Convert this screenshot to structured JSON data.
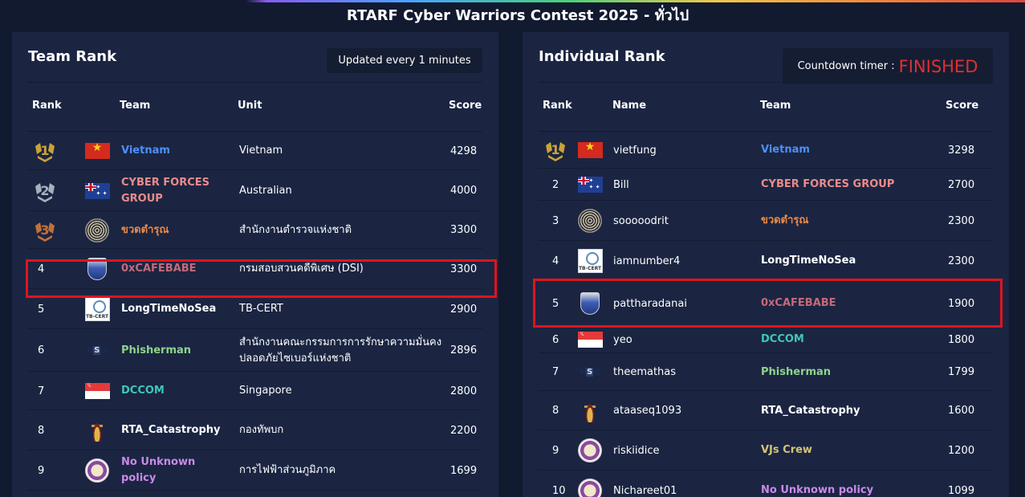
{
  "page": {
    "title": "RTARF Cyber Warriors Contest 2025 - ทั่วไป"
  },
  "team_rank": {
    "title": "Team Rank",
    "update_badge": "Updated every 1 minutes",
    "headers": {
      "rank": "Rank",
      "team": "Team",
      "unit": "Unit",
      "score": "Score"
    },
    "rows": [
      {
        "rank": "1",
        "rank_icon": "gold-medal-icon",
        "logo": "vietnam-flag-icon",
        "team": "Vietnam",
        "team_color": "#4f8ff7",
        "unit": "Vietnam",
        "score": "4298"
      },
      {
        "rank": "2",
        "rank_icon": "silver-medal-icon",
        "logo": "australia-flag-icon",
        "team": "CYBER FORCES GROUP",
        "team_color": "#ec8b8b",
        "unit": "Australian",
        "score": "4000"
      },
      {
        "rank": "3",
        "rank_icon": "bronze-medal-icon",
        "logo": "lace-logo-icon",
        "team": "ขวดตำรุณ",
        "team_color": "#e88a4a",
        "unit": "สำนักงานตำรวจแห่งชาติ",
        "score": "3300"
      },
      {
        "rank": "4",
        "logo": "shield-logo-icon",
        "team": "0xCAFEBABE",
        "team_color": "#c46a7a",
        "unit": "กรมสอบสวนคดีพิเศษ (DSI)",
        "score": "3300"
      },
      {
        "rank": "5",
        "logo": "tb-cert-logo-icon",
        "logo_text": "TB-CERT",
        "team": "LongTimeNoSea",
        "team_color": "#ffffff",
        "unit": "TB-CERT",
        "score": "2900"
      },
      {
        "rank": "6",
        "logo": "nsec-logo-icon",
        "team": "Phisherman",
        "team_color": "#8fd38a",
        "unit": "สำนักงานคณะกรรมการการรักษาความมั่นคงปลอดภัยไซเบอร์แห่งชาติ",
        "score": "2896"
      },
      {
        "rank": "7",
        "logo": "singapore-flag-icon",
        "team": "DCCOM",
        "team_color": "#3fc7b6",
        "unit": "Singapore",
        "score": "2800"
      },
      {
        "rank": "8",
        "logo": "army-emblem-icon",
        "team": "RTA_Catastrophy",
        "team_color": "#ffffff",
        "unit": "กองทัพบก",
        "score": "2200"
      },
      {
        "rank": "9",
        "logo": "purple-seal-icon",
        "team": "No Unknown policy",
        "team_color": "#c88ae8",
        "unit": "การไฟฟ้าส่วนภูมิภาค",
        "score": "1699"
      }
    ]
  },
  "individual_rank": {
    "title": "Individual Rank",
    "countdown_label": "Countdown timer :",
    "countdown_value": "FINISHED",
    "headers": {
      "rank": "Rank",
      "name": "Name",
      "team": "Team",
      "score": "Score"
    },
    "rows": [
      {
        "rank": "1",
        "rank_icon": "gold-medal-icon",
        "logo": "vietnam-flag-icon",
        "name": "vietfung",
        "team": "Vietnam",
        "team_color": "#4f8ff7",
        "score": "3298"
      },
      {
        "rank": "2",
        "logo": "australia-flag-icon",
        "name": "Bill",
        "team": "CYBER FORCES GROUP",
        "team_color": "#ec8b8b",
        "score": "2700"
      },
      {
        "rank": "3",
        "logo": "lace-logo-icon",
        "name": "sooooodrit",
        "team": "ขวดตำรุณ",
        "team_color": "#e88a4a",
        "score": "2300"
      },
      {
        "rank": "4",
        "logo": "tb-cert-logo-icon",
        "logo_text": "TB-CERT",
        "name": "iamnumber4",
        "team": "LongTimeNoSea",
        "team_color": "#ffffff",
        "score": "2300"
      },
      {
        "rank": "5",
        "logo": "shield-logo-icon",
        "name": "pattharadanai",
        "team": "0xCAFEBABE",
        "team_color": "#c46a7a",
        "score": "1900"
      },
      {
        "rank": "6",
        "logo": "singapore-flag-icon",
        "name": "yeo",
        "team": "DCCOM",
        "team_color": "#3fc7b6",
        "score": "1800"
      },
      {
        "rank": "7",
        "logo": "nsec-logo-icon",
        "name": "theemathas",
        "team": "Phisherman",
        "team_color": "#8fd38a",
        "score": "1799"
      },
      {
        "rank": "8",
        "logo": "army-emblem-icon",
        "name": "ataaseq1093",
        "team": "RTA_Catastrophy",
        "team_color": "#ffffff",
        "score": "1600"
      },
      {
        "rank": "9",
        "logo": "purple-seal-icon",
        "name": "riskiidice",
        "team": "VJs Crew",
        "team_color": "#d4c47a",
        "score": "1200"
      },
      {
        "rank": "10",
        "logo": "purple-seal-icon",
        "name": "Nichareet01",
        "team": "No Unknown policy",
        "team_color": "#c88ae8",
        "score": "1099"
      }
    ]
  },
  "colors": {
    "background": "#121a30",
    "panel": "#1b2542",
    "highlight": "#e0141e",
    "finished": "#e03030"
  }
}
